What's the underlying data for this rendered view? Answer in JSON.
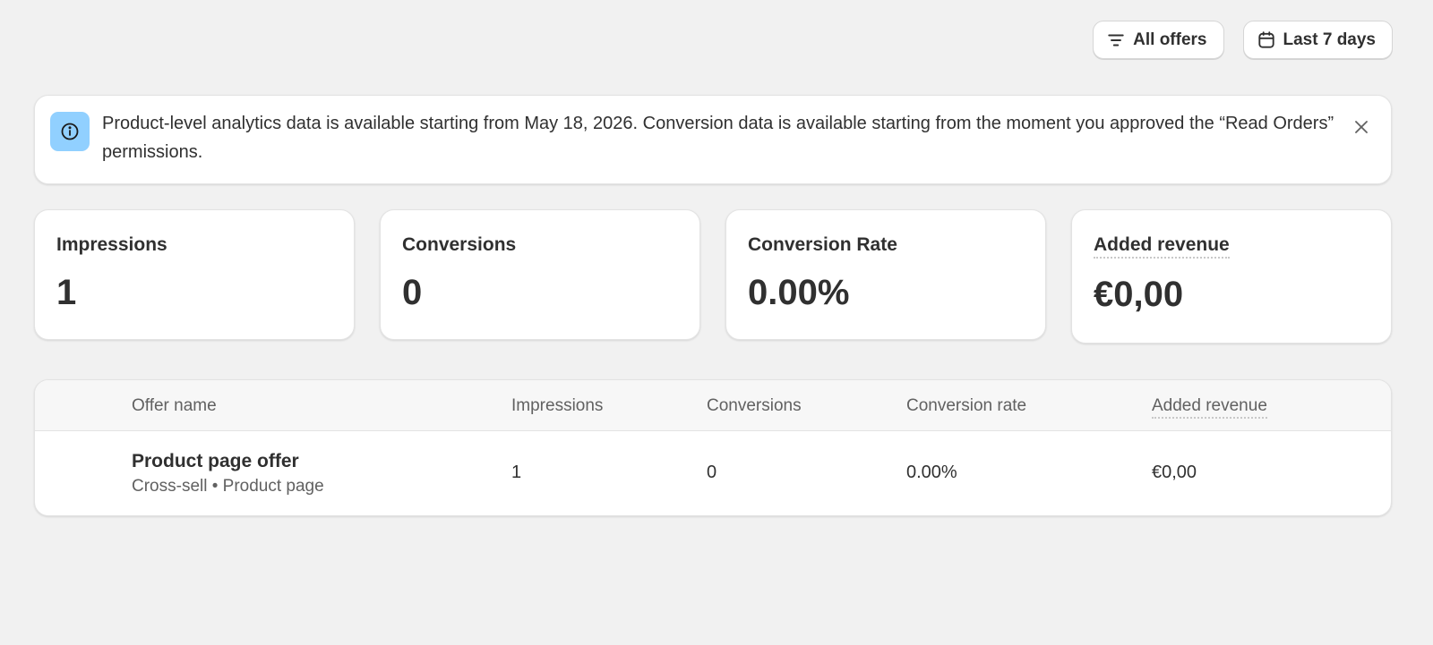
{
  "toolbar": {
    "filter_label": "All offers",
    "date_label": "Last 7 days"
  },
  "banner": {
    "message": "Product-level analytics data is available starting from May 18, 2026. Conversion data is available starting from the moment you approved the “Read Orders” permissions.",
    "icon": "info-icon",
    "accent": "#91d0ff"
  },
  "metrics": [
    {
      "label": "Impressions",
      "value": "1"
    },
    {
      "label": "Conversions",
      "value": "0"
    },
    {
      "label": "Conversion Rate",
      "value": "0.00%"
    },
    {
      "label": "Added revenue",
      "value": "€0,00"
    }
  ],
  "table": {
    "columns": [
      "Offer name",
      "Impressions",
      "Conversions",
      "Conversion rate",
      "Added revenue"
    ],
    "rows": [
      {
        "name": "Product page offer",
        "subtitle": "Cross-sell • Product page",
        "impressions": "1",
        "conversions": "0",
        "rate": "0.00%",
        "revenue": "€0,00"
      }
    ]
  }
}
